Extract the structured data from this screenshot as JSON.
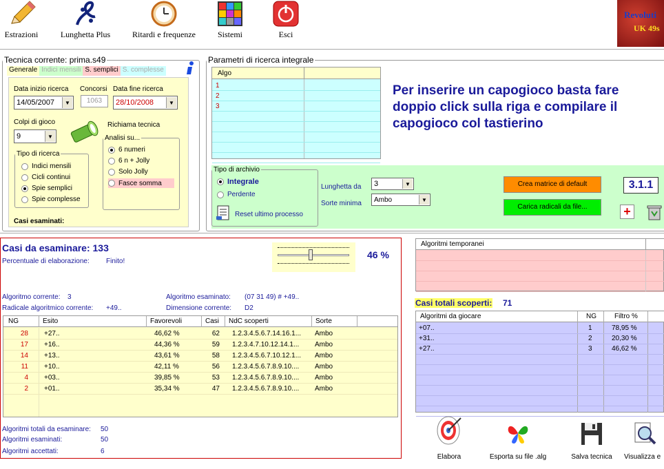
{
  "toolbar": {
    "buttons": [
      {
        "label": "Estrazioni",
        "icon": "pencil-icon"
      },
      {
        "label": "Lunghetta Plus",
        "icon": "lottery-logo-icon"
      },
      {
        "label": "Ritardi e frequenze",
        "icon": "clock-icon"
      },
      {
        "label": "Sistemi",
        "icon": "grid-icon"
      },
      {
        "label": "Esci",
        "icon": "power-icon"
      }
    ],
    "logo_line1": "Revoluti",
    "logo_line2": "UK 49s"
  },
  "tecnica": {
    "legend": "Tecnica corrente: prima.s49",
    "tabs": [
      "Generale",
      "Indici mensili",
      "S. semplici",
      "S. complesse"
    ],
    "data_inizio_label": "Data inizio ricerca",
    "data_inizio_value": "14/05/2007",
    "concorsi_label": "Concorsi",
    "concorsi_value": "1063",
    "data_fine_label": "Data fine ricerca",
    "data_fine_value": "28/10/2008",
    "colpi_label": "Colpi di gioco",
    "colpi_value": "9",
    "richiama_label": "Richiama tecnica",
    "tipo_legend": "Tipo di ricerca",
    "tipo_options": [
      "Indici mensili",
      "Cicli continui",
      "Spie semplici",
      "Spie complesse"
    ],
    "tipo_selected": 2,
    "analisi_legend": "Analisi su...",
    "analisi_options": [
      "6 numeri",
      "6 n + Jolly",
      "Solo Jolly",
      "Fasce somma"
    ],
    "analisi_selected": 0,
    "casi_esaminati_label": "Casi esaminati:"
  },
  "parametri": {
    "legend": "Parametri di ricerca integrale",
    "algo_header": "Algo",
    "algo_rows": [
      "1",
      "2",
      "3"
    ],
    "info_text": "Per inserire un capogioco basta fare doppio click sulla riga e compilare il capogioco col tastierino",
    "archivio_legend": "Tipo di archivio",
    "archivio_options": [
      "Integrale",
      "Perdente"
    ],
    "archivio_selected": 0,
    "reset_label": "Reset ultimo processo",
    "lunghetta_label": "Lunghetta da",
    "lunghetta_value": "3",
    "sorte_label": "Sorte minima",
    "sorte_value": "Ambo",
    "crea_label": "Crea matrice di default",
    "carica_label": "Carica radicali da file...",
    "version": "3.1.1",
    "colors": {
      "crea": "#ff8c00",
      "carica": "#00ee00"
    }
  },
  "progress": {
    "title": "Casi da esaminare: 133",
    "perc_label": "Percentuale di elaborazione:",
    "perc_status": "Finito!",
    "percent": "46 %",
    "slider_fraction": 0.46,
    "algo_corrente_label": "Algoritmo corrente:",
    "algo_corrente_value": "3",
    "algo_esaminato_label": "Algoritmo esaminato:",
    "algo_esaminato_value": "(07 31 49) # +49..",
    "radicale_label": "Radicale algoritmico corrente:",
    "radicale_value": "+49..",
    "dimensione_label": "Dimensione corrente:",
    "dimensione_value": "D2"
  },
  "results": {
    "headers": [
      "NG",
      "Esito",
      "Favorevoli",
      "Casi",
      "NdC scoperti",
      "Sorte"
    ],
    "rows": [
      {
        "ng": "28",
        "esito": "+27..",
        "fav": "46,62 %",
        "casi": "62",
        "ndc": "1.2.3.4.5.6.7.14.16.1...",
        "sorte": "Ambo"
      },
      {
        "ng": "17",
        "esito": "+16..",
        "fav": "44,36 %",
        "casi": "59",
        "ndc": "1.2.3.4.7.10.12.14.1...",
        "sorte": "Ambo"
      },
      {
        "ng": "14",
        "esito": "+13..",
        "fav": "43,61 %",
        "casi": "58",
        "ndc": "1.2.3.4.5.6.7.10.12.1...",
        "sorte": "Ambo"
      },
      {
        "ng": "11",
        "esito": "+10..",
        "fav": "42,11 %",
        "casi": "56",
        "ndc": "1.2.3.4.5.6.7.8.9.10....",
        "sorte": "Ambo"
      },
      {
        "ng": "4",
        "esito": "+03..",
        "fav": "39,85 %",
        "casi": "53",
        "ndc": "1.2.3.4.5.6.7.8.9.10....",
        "sorte": "Ambo"
      },
      {
        "ng": "2",
        "esito": "+01..",
        "fav": "35,34 %",
        "casi": "47",
        "ndc": "1.2.3.4.5.6.7.8.9.10....",
        "sorte": "Ambo"
      }
    ],
    "tot_label": "Algoritmi totali da esaminare:",
    "tot_value": "50",
    "esam_label": "Algoritmi esaminati:",
    "esam_value": "50",
    "acc_label": "Algoritmi accettati:",
    "acc_value": "6"
  },
  "temporanei": {
    "header": "Algoritmi temporanei"
  },
  "scoperti": {
    "label": "Casi totali scoperti:",
    "value": "71",
    "headers": [
      "Algoritmi da giocare",
      "NG",
      "Filtro %"
    ],
    "rows": [
      {
        "algo": "+07..",
        "ng": "1",
        "filtro": "78,95 %"
      },
      {
        "algo": "+31..",
        "ng": "2",
        "filtro": "20,30 %"
      },
      {
        "algo": "+27..",
        "ng": "3",
        "filtro": "46,62 %"
      }
    ]
  },
  "actions": [
    {
      "label": "Elabora",
      "icon": "target-icon"
    },
    {
      "label": "Esporta su file .alg",
      "icon": "butterfly-icon"
    },
    {
      "label": "Salva tecnica",
      "icon": "floppy-icon"
    },
    {
      "label": "Visualizza e",
      "icon": "magnifier-icon"
    }
  ]
}
